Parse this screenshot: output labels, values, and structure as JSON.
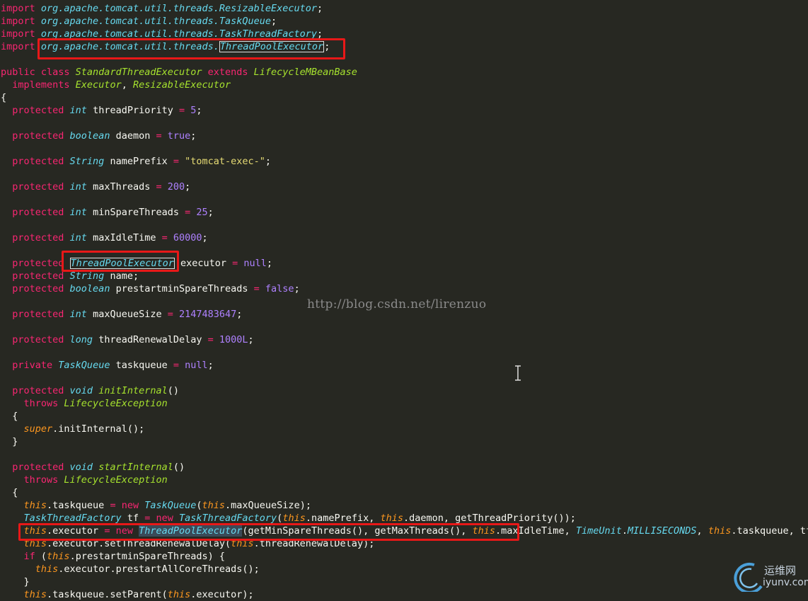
{
  "code": {
    "lines": [
      [
        [
          "kw",
          "import "
        ],
        [
          "pkg",
          "org.apache.tomcat.util.threads.ResizableExecutor"
        ],
        [
          "plain",
          ";"
        ]
      ],
      [
        [
          "kw",
          "import "
        ],
        [
          "pkg",
          "org.apache.tomcat.util.threads.TaskQueue"
        ],
        [
          "plain",
          ";"
        ]
      ],
      [
        [
          "kw",
          "import "
        ],
        [
          "pkg",
          "org.apache.tomcat.util.threads.TaskThreadFactory"
        ],
        [
          "plain",
          ";"
        ]
      ],
      [
        [
          "kw",
          "import "
        ],
        [
          "pkg",
          "org.apache.tomcat.util.threads."
        ],
        [
          "hl",
          "ThreadPoolExecutor"
        ],
        [
          "plain",
          ";"
        ]
      ],
      [],
      [
        [
          "kw",
          "public class "
        ],
        [
          "cls",
          "StandardThreadExecutor "
        ],
        [
          "kw",
          "extends "
        ],
        [
          "cls",
          "LifecycleMBeanBase"
        ]
      ],
      [
        [
          "plain",
          "  "
        ],
        [
          "kw",
          "implements "
        ],
        [
          "cls",
          "Executor"
        ],
        [
          "plain",
          ", "
        ],
        [
          "cls",
          "ResizableExecutor"
        ]
      ],
      [
        [
          "plain",
          "{"
        ]
      ],
      [
        [
          "plain",
          "  "
        ],
        [
          "kw",
          "protected "
        ],
        [
          "type",
          "int "
        ],
        [
          "plain",
          "threadPriority "
        ],
        [
          "kw",
          "= "
        ],
        [
          "num",
          "5"
        ],
        [
          "plain",
          ";"
        ]
      ],
      [],
      [
        [
          "plain",
          "  "
        ],
        [
          "kw",
          "protected "
        ],
        [
          "type",
          "boolean "
        ],
        [
          "plain",
          "daemon "
        ],
        [
          "kw",
          "= "
        ],
        [
          "num",
          "true"
        ],
        [
          "plain",
          ";"
        ]
      ],
      [],
      [
        [
          "plain",
          "  "
        ],
        [
          "kw",
          "protected "
        ],
        [
          "type",
          "String "
        ],
        [
          "plain",
          "namePrefix "
        ],
        [
          "kw",
          "= "
        ],
        [
          "str",
          "\"tomcat-exec-\""
        ],
        [
          "plain",
          ";"
        ]
      ],
      [],
      [
        [
          "plain",
          "  "
        ],
        [
          "kw",
          "protected "
        ],
        [
          "type",
          "int "
        ],
        [
          "plain",
          "maxThreads "
        ],
        [
          "kw",
          "= "
        ],
        [
          "num",
          "200"
        ],
        [
          "plain",
          ";"
        ]
      ],
      [],
      [
        [
          "plain",
          "  "
        ],
        [
          "kw",
          "protected "
        ],
        [
          "type",
          "int "
        ],
        [
          "plain",
          "minSpareThreads "
        ],
        [
          "kw",
          "= "
        ],
        [
          "num",
          "25"
        ],
        [
          "plain",
          ";"
        ]
      ],
      [],
      [
        [
          "plain",
          "  "
        ],
        [
          "kw",
          "protected "
        ],
        [
          "type",
          "int "
        ],
        [
          "plain",
          "maxIdleTime "
        ],
        [
          "kw",
          "= "
        ],
        [
          "num",
          "60000"
        ],
        [
          "plain",
          ";"
        ]
      ],
      [],
      [
        [
          "plain",
          "  "
        ],
        [
          "kw",
          "protected "
        ],
        [
          "hl",
          "ThreadPoolExecutor"
        ],
        [
          "plain",
          " executor "
        ],
        [
          "kw",
          "= "
        ],
        [
          "num",
          "null"
        ],
        [
          "plain",
          ";"
        ]
      ],
      [
        [
          "plain",
          "  "
        ],
        [
          "kw",
          "protected "
        ],
        [
          "type",
          "String "
        ],
        [
          "plain",
          "name;"
        ]
      ],
      [
        [
          "plain",
          "  "
        ],
        [
          "kw",
          "protected "
        ],
        [
          "type",
          "boolean "
        ],
        [
          "plain",
          "prestartminSpareThreads "
        ],
        [
          "kw",
          "= "
        ],
        [
          "num",
          "false"
        ],
        [
          "plain",
          ";"
        ]
      ],
      [],
      [
        [
          "plain",
          "  "
        ],
        [
          "kw",
          "protected "
        ],
        [
          "type",
          "int "
        ],
        [
          "plain",
          "maxQueueSize "
        ],
        [
          "kw",
          "= "
        ],
        [
          "num",
          "2147483647"
        ],
        [
          "plain",
          ";"
        ]
      ],
      [],
      [
        [
          "plain",
          "  "
        ],
        [
          "kw",
          "protected "
        ],
        [
          "type",
          "long "
        ],
        [
          "plain",
          "threadRenewalDelay "
        ],
        [
          "kw",
          "= "
        ],
        [
          "num",
          "1000L"
        ],
        [
          "plain",
          ";"
        ]
      ],
      [],
      [
        [
          "plain",
          "  "
        ],
        [
          "kw",
          "private "
        ],
        [
          "type",
          "TaskQueue "
        ],
        [
          "plain",
          "taskqueue "
        ],
        [
          "kw",
          "= "
        ],
        [
          "num",
          "null"
        ],
        [
          "plain",
          ";"
        ]
      ],
      [],
      [
        [
          "plain",
          "  "
        ],
        [
          "kw",
          "protected "
        ],
        [
          "type",
          "void "
        ],
        [
          "cls",
          "initInternal"
        ],
        [
          "plain",
          "()"
        ]
      ],
      [
        [
          "plain",
          "    "
        ],
        [
          "kw",
          "throws "
        ],
        [
          "cls",
          "LifecycleException"
        ]
      ],
      [
        [
          "plain",
          "  {"
        ]
      ],
      [
        [
          "plain",
          "    "
        ],
        [
          "this",
          "super"
        ],
        [
          "plain",
          ".initInternal();"
        ]
      ],
      [
        [
          "plain",
          "  }"
        ]
      ],
      [],
      [
        [
          "plain",
          "  "
        ],
        [
          "kw",
          "protected "
        ],
        [
          "type",
          "void "
        ],
        [
          "cls",
          "startInternal"
        ],
        [
          "plain",
          "()"
        ]
      ],
      [
        [
          "plain",
          "    "
        ],
        [
          "kw",
          "throws "
        ],
        [
          "cls",
          "LifecycleException"
        ]
      ],
      [
        [
          "plain",
          "  {"
        ]
      ],
      [
        [
          "plain",
          "    "
        ],
        [
          "this",
          "this"
        ],
        [
          "plain",
          ".taskqueue "
        ],
        [
          "kw",
          "= new "
        ],
        [
          "type",
          "TaskQueue"
        ],
        [
          "plain",
          "("
        ],
        [
          "this",
          "this"
        ],
        [
          "plain",
          ".maxQueueSize);"
        ]
      ],
      [
        [
          "plain",
          "    "
        ],
        [
          "type",
          "TaskThreadFactory "
        ],
        [
          "plain",
          "tf "
        ],
        [
          "kw",
          "= new "
        ],
        [
          "type",
          "TaskThreadFactory"
        ],
        [
          "plain",
          "("
        ],
        [
          "this",
          "this"
        ],
        [
          "plain",
          ".namePrefix, "
        ],
        [
          "this",
          "this"
        ],
        [
          "plain",
          ".daemon, getThreadPriority());"
        ]
      ],
      [
        [
          "plain",
          "    "
        ],
        [
          "this",
          "this"
        ],
        [
          "plain",
          ".executor "
        ],
        [
          "kw",
          "= new "
        ],
        [
          "hl2",
          "ThreadPoolExecutor"
        ],
        [
          "plain",
          "(getMinSpareThreads(), getMaxThreads(), "
        ],
        [
          "this",
          "this"
        ],
        [
          "plain",
          ".maxIdleTime, "
        ],
        [
          "type",
          "TimeUnit"
        ],
        [
          "plain",
          "."
        ],
        [
          "type",
          "MILLISECONDS"
        ],
        [
          "plain",
          ", "
        ],
        [
          "this",
          "this"
        ],
        [
          "plain",
          ".taskqueue, tf);"
        ]
      ],
      [
        [
          "plain",
          "    "
        ],
        [
          "this",
          "this"
        ],
        [
          "plain",
          ".executor.setThreadRenewalDelay("
        ],
        [
          "this",
          "this"
        ],
        [
          "plain",
          ".threadRenewalDelay);"
        ]
      ],
      [
        [
          "plain",
          "    "
        ],
        [
          "kw",
          "if "
        ],
        [
          "plain",
          "("
        ],
        [
          "this",
          "this"
        ],
        [
          "plain",
          ".prestartminSpareThreads) {"
        ]
      ],
      [
        [
          "plain",
          "      "
        ],
        [
          "this",
          "this"
        ],
        [
          "plain",
          ".executor.prestartAllCoreThreads();"
        ]
      ],
      [
        [
          "plain",
          "    }"
        ]
      ],
      [
        [
          "plain",
          "    "
        ],
        [
          "this",
          "this"
        ],
        [
          "plain",
          ".taskqueue.setParent("
        ],
        [
          "this",
          "this"
        ],
        [
          "plain",
          ".executor);"
        ]
      ]
    ]
  },
  "watermark": {
    "url": "http://blog.csdn.net/lirenzuo"
  },
  "logo": {
    "cn": "运维网",
    "en": "iyunv.com"
  },
  "colors": {
    "background": "#272822",
    "annotation": "#e81818"
  }
}
